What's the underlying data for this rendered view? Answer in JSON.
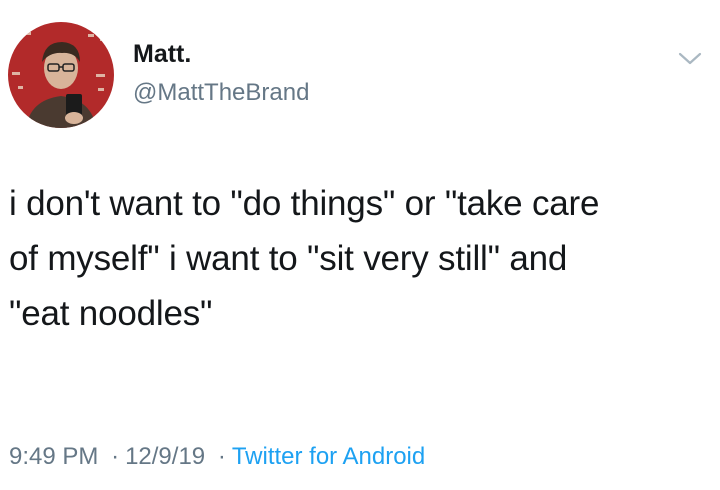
{
  "user": {
    "display_name": "Matt.",
    "handle": "@MattTheBrand"
  },
  "tweet": {
    "lines": [
      "i don't want to \"do things\" or \"take care",
      "of myself\" i want to \"sit very still\" and",
      "\"eat noodles\""
    ]
  },
  "meta": {
    "time": "9:49 PM",
    "separator": "·",
    "date": "12/9/19",
    "source": "Twitter for Android"
  },
  "icons": {
    "menu": "chevron-down-icon",
    "avatar": "avatar"
  },
  "colors": {
    "text": "#14171a",
    "secondary": "#657786",
    "link": "#1da1f2",
    "avatar_bg": "#b22a2a"
  }
}
